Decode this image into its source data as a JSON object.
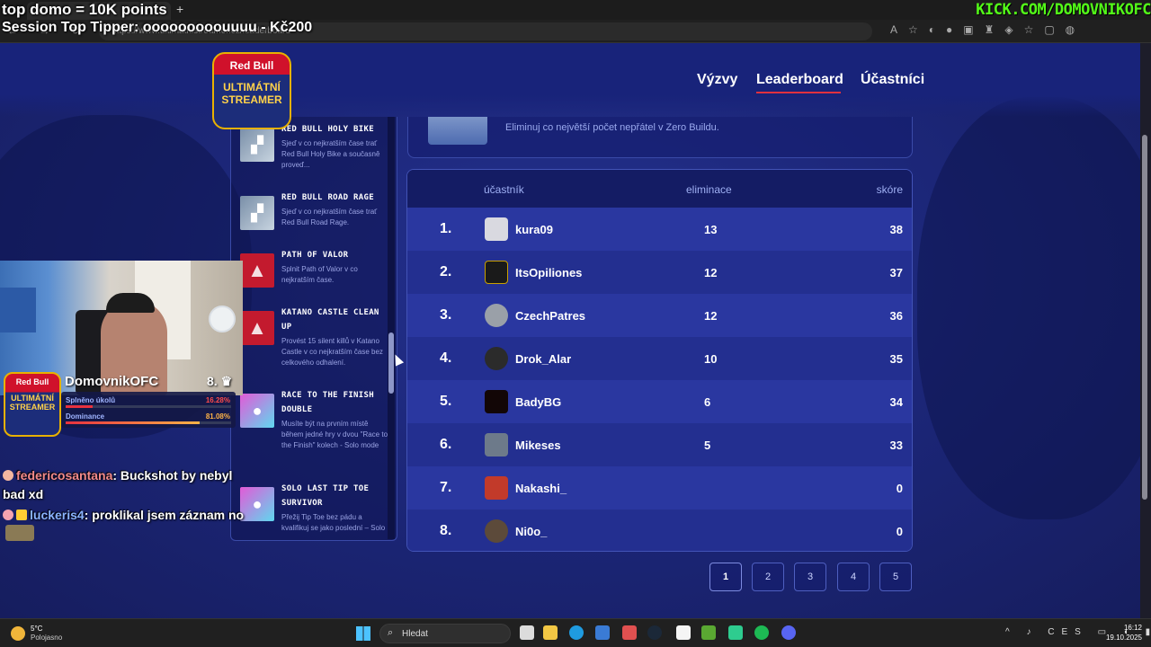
{
  "overlay": {
    "line1": "top domo = 10K points",
    "line2": "Session Top Tipper: ooooooooouuuu - Kč200",
    "kick": "KICK.COM/DOMOVNIKOFC"
  },
  "browser": {
    "url": "https://www.ultimatnistreamer.cz/leaderboard"
  },
  "site": {
    "logo": {
      "line1": "Red Bull",
      "line2": "ULTIMÁTNÍ",
      "line3": "STREAMER"
    },
    "nav": {
      "vyzvy": "Výzvy",
      "leaderboard": "Leaderboard",
      "ucastnici": "Účastníci"
    },
    "challenge_card_text": "Eliminuj co největší počet nepřátel v Zero Buildu.",
    "challenges": [
      {
        "title": "RED BULL HOLY BIKE",
        "desc": "Sjeď v co nejkratším čase trať Red Bull Holy Bike a současně proveď...",
        "icon": "bike-icon",
        "color": "blue"
      },
      {
        "title": "RED BULL ROAD RAGE",
        "desc": "Sjeď v co nejkratším čase trať Red Bull Road Rage.",
        "icon": "road-icon",
        "color": "blue"
      },
      {
        "title": "PATH OF VALOR",
        "desc": "Splnit Path of Valor v co nejkratším čase.",
        "icon": "assassin-icon",
        "color": "red"
      },
      {
        "title": "KATANO CASTLE CLEAN UP",
        "desc": "Provést 15 silent killů v Katano Castle v co nejkratším čase bez celkového odhalení.",
        "icon": "assassin-icon",
        "color": "red"
      },
      {
        "title": "RACE TO THE FINISH DOUBLE",
        "desc": "Musíte být na prvním místě během jedné hry v dvou \"Race to the Finish\" kolech - Solo mode",
        "icon": "fall-guy-icon",
        "color": "pink"
      },
      {
        "title": "SOLO LAST TIP TOE SURVIVOR",
        "desc": "Přežij Tip Toe bez pádu a kvalifikuj se jako poslední – Solo",
        "icon": "fall-guy-icon",
        "color": "pink"
      }
    ],
    "leaderboard": {
      "headers": {
        "participant": "účastník",
        "eliminations": "eliminace",
        "score": "skóre"
      },
      "rows": [
        {
          "rank": "1.",
          "name": "kura09",
          "elim": "13",
          "score": "38",
          "avatar": "#d9d9e0"
        },
        {
          "rank": "2.",
          "name": "ItsOpiliones",
          "elim": "12",
          "score": "37",
          "avatar": "#1a1a1a"
        },
        {
          "rank": "3.",
          "name": "CzechPatres",
          "elim": "12",
          "score": "36",
          "avatar": "#9aa0a8"
        },
        {
          "rank": "4.",
          "name": "Drok_Alar",
          "elim": "10",
          "score": "35",
          "avatar": "#2b2b2b"
        },
        {
          "rank": "5.",
          "name": "BadyBG",
          "elim": "6",
          "score": "34",
          "avatar": "#120606"
        },
        {
          "rank": "6.",
          "name": "Mikeses",
          "elim": "5",
          "score": "33",
          "avatar": "#6d7a8a"
        },
        {
          "rank": "7.",
          "name": "Nakashi_",
          "elim": "",
          "score": "0",
          "avatar": "#c23a2a"
        },
        {
          "rank": "8.",
          "name": "Ni0o_",
          "elim": "",
          "score": "0",
          "avatar": "#5c4a3a"
        }
      ]
    },
    "pages": [
      "1",
      "2",
      "3",
      "4",
      "5"
    ]
  },
  "stream": {
    "name": "DomovnikOFC",
    "rank": "8.",
    "stat1_label": "Splněno úkolů",
    "stat1_value": "16.28%",
    "stat1_fraction": 0.1628,
    "stat2_label": "Dominance",
    "stat2_value": "81.08%",
    "stat2_fraction": 0.8108,
    "chat": [
      {
        "user": "federicosantana",
        "msg": ": Buckshot by nebyl bad xd"
      },
      {
        "user": "luckeris4",
        "msg": ": proklikal jsem záznam no"
      }
    ]
  },
  "taskbar": {
    "temp": "5°C",
    "condition": "Polojasno",
    "search": "Hledat",
    "lang": "CES",
    "time": "16:12",
    "date": "19.10.2025"
  }
}
